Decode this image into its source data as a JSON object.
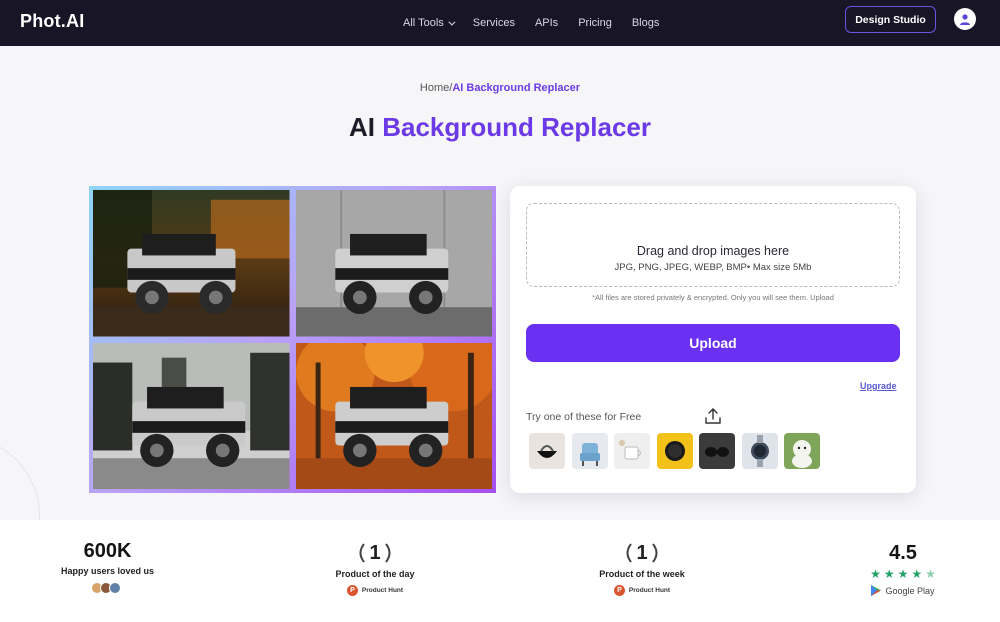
{
  "nav": {
    "logo": "Phot.AI",
    "links": [
      {
        "label": "All Tools",
        "has_dropdown": true
      },
      {
        "label": "Services"
      },
      {
        "label": "APIs"
      },
      {
        "label": "Pricing"
      },
      {
        "label": "Blogs"
      }
    ],
    "design_studio": "Design Studio",
    "avatar_icon": "user-icon"
  },
  "breadcrumb": {
    "home": "Home",
    "separator": "/",
    "current": "AI Background Replacer"
  },
  "title": {
    "prefix": "AI ",
    "accent": "Background Replacer"
  },
  "collage": {
    "tiles": [
      "jeep-on-autumn-sunset-road",
      "jeep-on-concrete-wall",
      "jeep-in-forest-road",
      "jeep-in-orange-autumn-forest"
    ]
  },
  "upload": {
    "icon": "upload-icon",
    "drag_title": "Drag and drop images here",
    "formats": "JPG, PNG, JPEG, WEBP, BMP• Max size 5Mb",
    "privacy": "*All files are stored privately & encrypted. Only you will see them. Upload",
    "button": "Upload",
    "upgrade": "Upgrade",
    "try_label": "Try one of these for Free",
    "samples": [
      "handbag",
      "armchair",
      "cup",
      "watch-yellow",
      "sunglasses",
      "watch-steel",
      "dog"
    ]
  },
  "stats": {
    "users": {
      "value": "600K",
      "label": "Happy users loved us"
    },
    "day": {
      "rank": "1",
      "label": "Product of the day",
      "badge": "Product Hunt"
    },
    "week": {
      "rank": "1",
      "label": "Product of the week",
      "badge": "Product Hunt"
    },
    "rating": {
      "value": "4.5",
      "stars": 4.5,
      "store": "Google Play"
    }
  },
  "colors": {
    "accent": "#6a31f2",
    "nav_bg": "#181527",
    "star": "#21a366"
  }
}
